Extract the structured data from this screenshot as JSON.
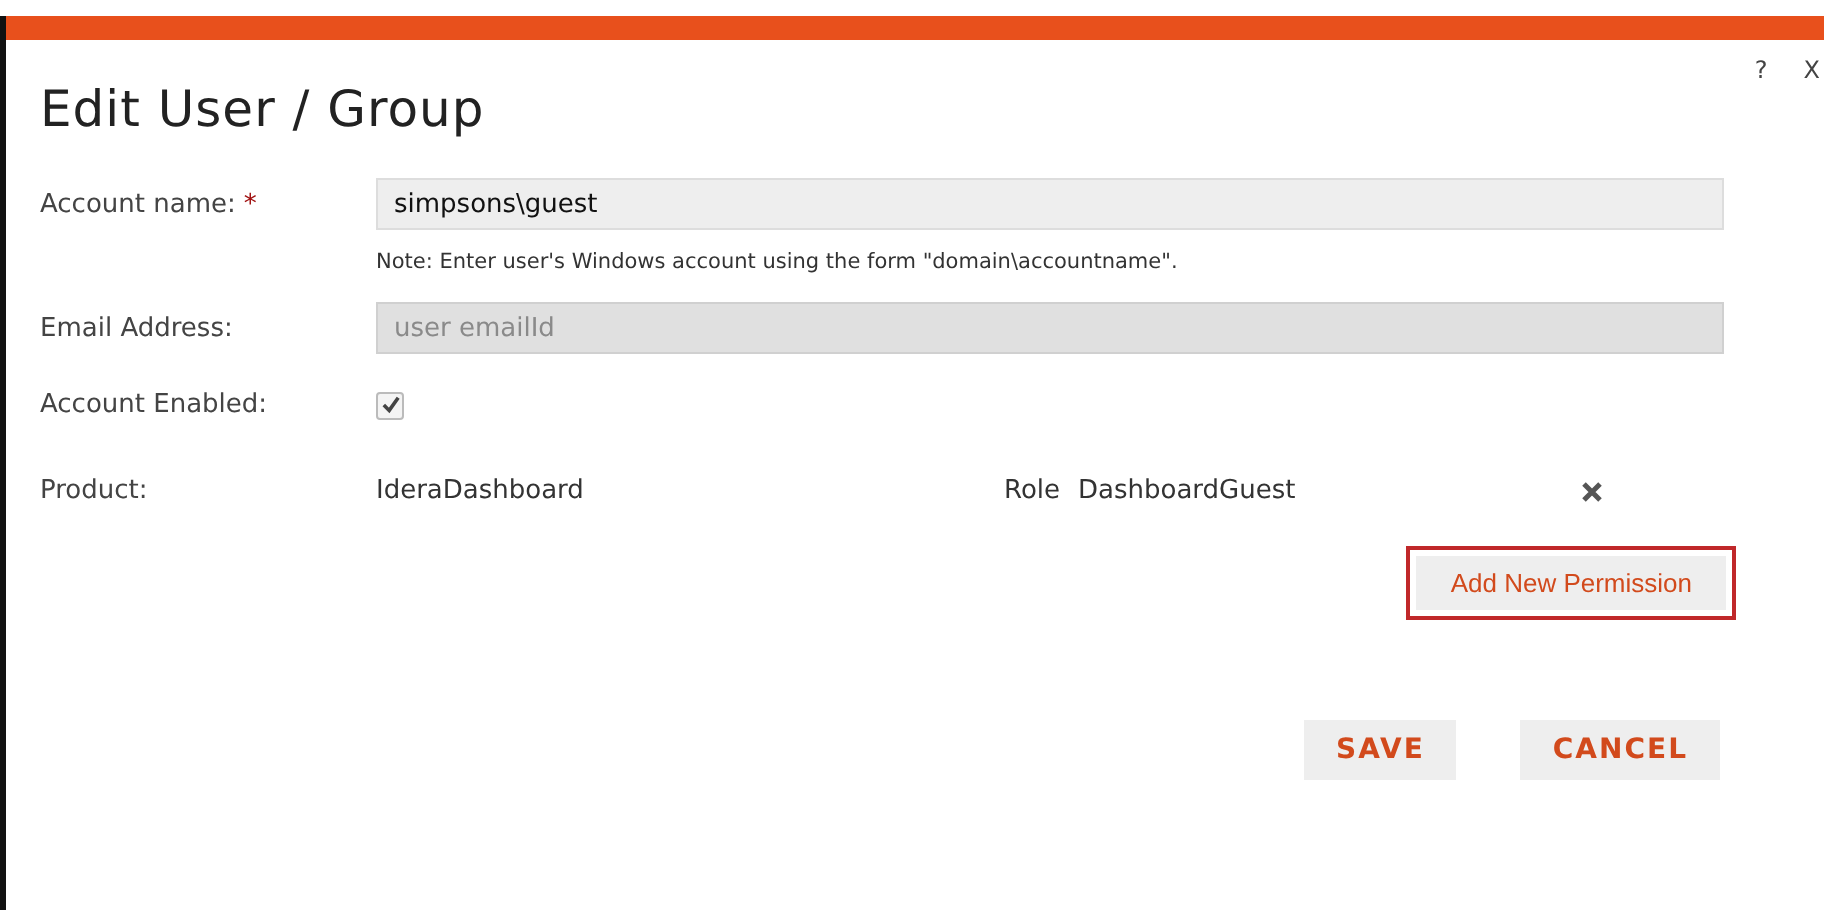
{
  "dialog": {
    "title": "Edit User / Group",
    "help": "?",
    "close": "X"
  },
  "account_name": {
    "label": "Account name:",
    "required_mark": "*",
    "value": "simpsons\\guest",
    "note": "Note: Enter user's Windows account using the form \"domain\\accountname\"."
  },
  "email": {
    "label": "Email Address:",
    "placeholder": "user emailId",
    "disabled": true
  },
  "account_enabled": {
    "label": "Account Enabled:",
    "checked": true
  },
  "permissions": [
    {
      "product_label": "Product:",
      "product": "IderaDashboard",
      "role_label": "Role",
      "role": "DashboardGuest"
    }
  ],
  "add_button": "Add New Permission",
  "buttons": [
    "SAVE",
    "CANCEL"
  ]
}
